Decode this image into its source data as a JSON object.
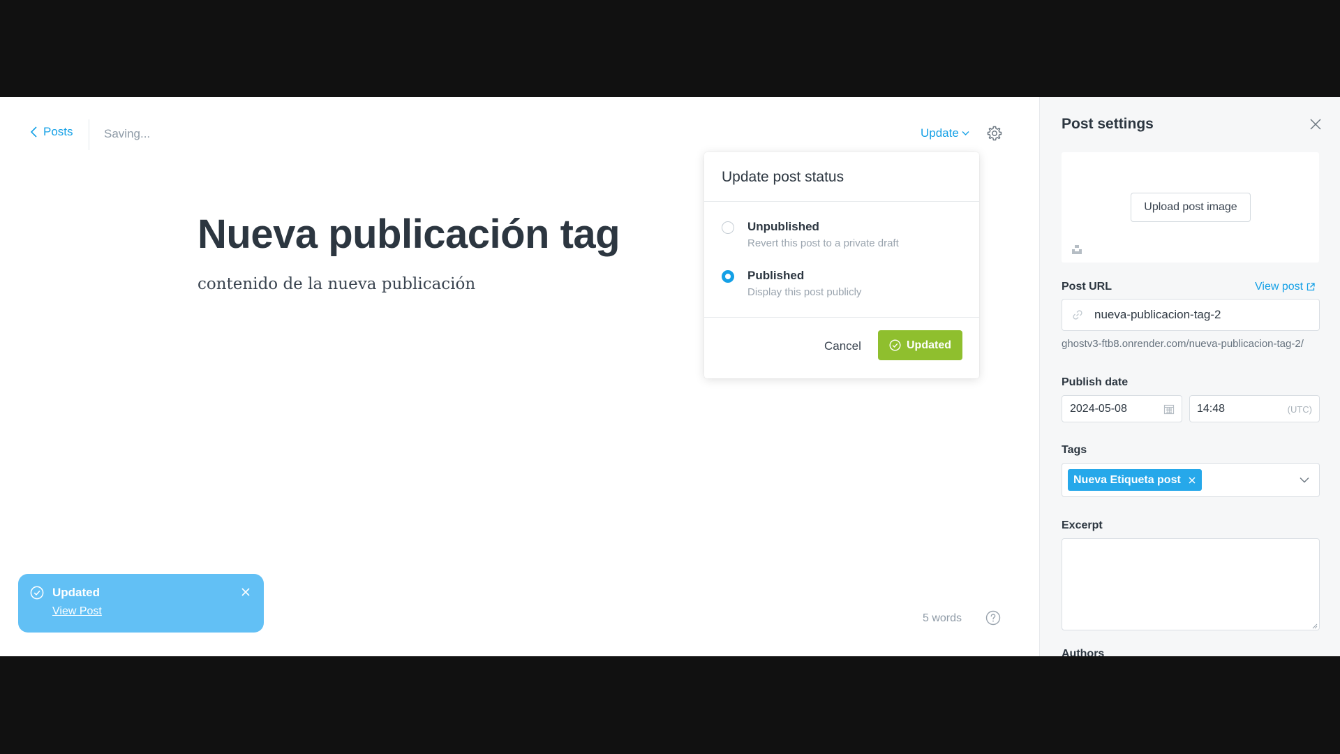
{
  "header": {
    "back_label": "Posts",
    "saving_label": "Saving...",
    "update_label": "Update"
  },
  "post": {
    "title": "Nueva publicación tag",
    "body": "contenido de la nueva publicación",
    "word_count": "5 words"
  },
  "status_popup": {
    "title": "Update post status",
    "options": [
      {
        "label": "Unpublished",
        "description": "Revert this post to a private draft",
        "selected": false
      },
      {
        "label": "Published",
        "description": "Display this post publicly",
        "selected": true
      }
    ],
    "cancel_label": "Cancel",
    "confirm_label": "Updated"
  },
  "toast": {
    "title": "Updated",
    "link": "View Post"
  },
  "settings": {
    "title": "Post settings",
    "upload_label": "Upload post image",
    "post_url_label": "Post URL",
    "view_post_label": "View post",
    "slug": "nueva-publicacion-tag-2",
    "url_hint": "ghostv3-ftb8.onrender.com/nueva-publicacion-tag-2/",
    "publish_date_label": "Publish date",
    "date": "2024-05-08",
    "time": "14:48",
    "timezone": "(UTC)",
    "tags_label": "Tags",
    "tags": [
      "Nueva Etiqueta post"
    ],
    "excerpt_label": "Excerpt",
    "excerpt_value": "",
    "authors_label": "Authors"
  },
  "colors": {
    "accent": "#14a0e6",
    "success": "#8fbf2e",
    "toast": "#62c0f5",
    "tag": "#26a8ea"
  }
}
